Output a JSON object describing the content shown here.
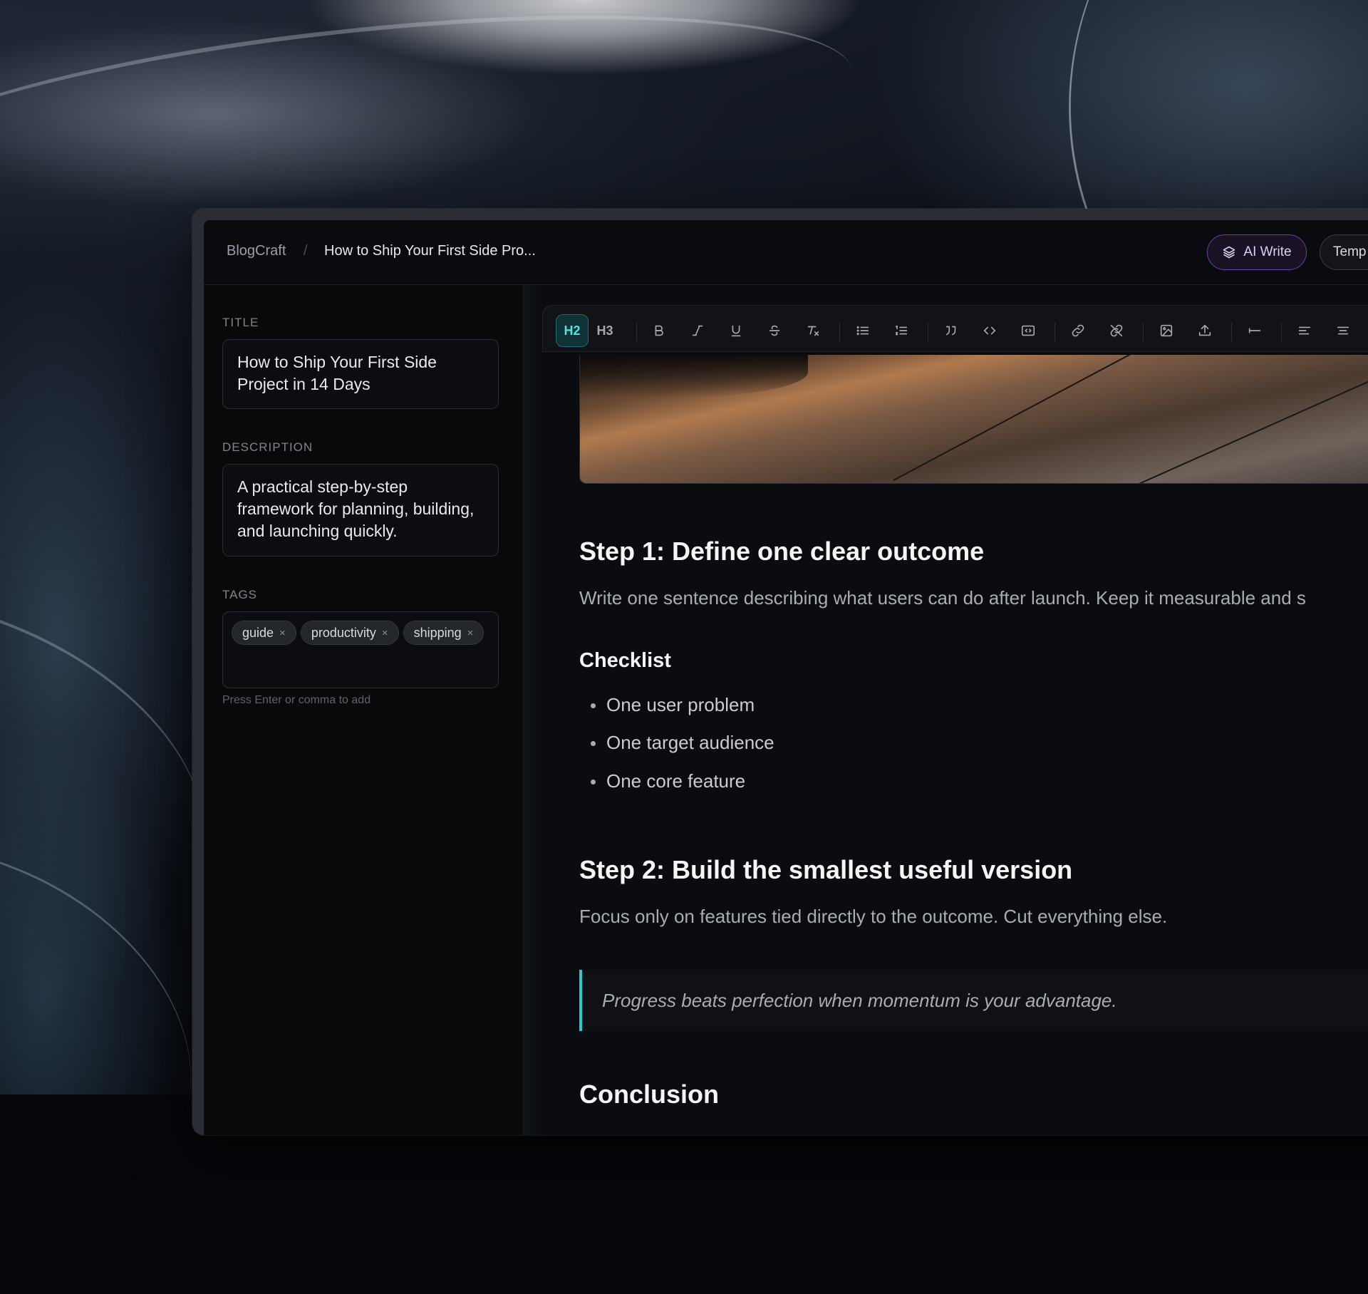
{
  "breadcrumb": {
    "app": "BlogCraft",
    "separator": "/",
    "page": "How to Ship Your First Side Pro..."
  },
  "header": {
    "ai_write_label": "AI Write",
    "templates_label": "Temp"
  },
  "sidebar": {
    "title_label": "TITLE",
    "title_value": "How to Ship Your First Side Project in 14 Days",
    "description_label": "DESCRIPTION",
    "description_value": "A practical step-by-step framework for planning, building, and launching quickly.",
    "tags_label": "TAGS",
    "tags": [
      "guide",
      "productivity",
      "shipping"
    ],
    "tag_remove": "×",
    "tags_hint": "Press Enter or comma to add"
  },
  "toolbar": {
    "h2": "H2",
    "h3": "H3",
    "active": "H2",
    "icons": [
      "bold-icon",
      "italic-icon",
      "underline-icon",
      "strikethrough-icon",
      "clear-format-icon",
      "bullet-list-icon",
      "numbered-list-icon",
      "blockquote-icon",
      "inline-code-icon",
      "code-block-icon",
      "link-icon",
      "unlink-icon",
      "image-icon",
      "upload-icon",
      "horizontal-rule-icon",
      "align-left-icon",
      "align-center-icon"
    ]
  },
  "content": {
    "step1_heading": "Step 1: Define one clear outcome",
    "step1_paragraph": "Write one sentence describing what users can do after launch. Keep it measurable and s",
    "checklist_heading": "Checklist",
    "checklist_items": [
      "One user problem",
      "One target audience",
      "One core feature"
    ],
    "step2_heading": "Step 2: Build the smallest useful version",
    "step2_paragraph": "Focus only on features tied directly to the outcome. Cut everything else.",
    "quote": "Progress beats perfection when momentum is your advantage.",
    "conclusion_heading": "Conclusion"
  },
  "colors": {
    "accent": "#2ec6d0",
    "ai_purple": "#6b3fa8"
  }
}
